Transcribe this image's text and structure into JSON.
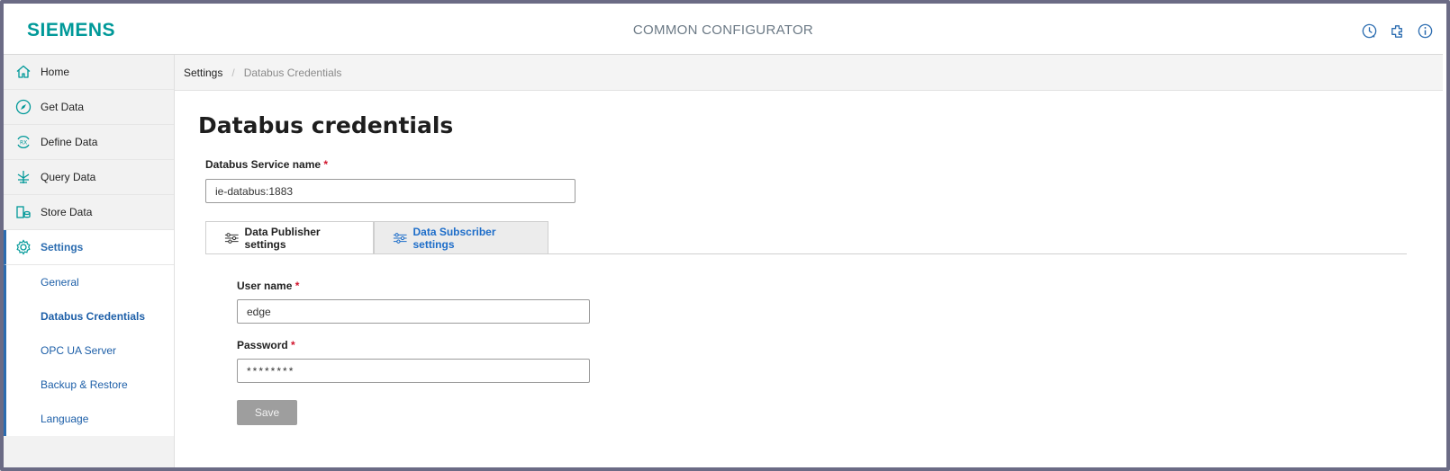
{
  "header": {
    "logo": "SIEMENS",
    "app_title": "COMMON CONFIGURATOR",
    "icons": [
      "history-icon",
      "plugin-icon",
      "info-icon"
    ],
    "brand_color": "#009999"
  },
  "sidebar": {
    "items": [
      {
        "label": "Home",
        "icon": "home-icon"
      },
      {
        "label": "Get Data",
        "icon": "get-data-icon"
      },
      {
        "label": "Define Data",
        "icon": "define-data-icon"
      },
      {
        "label": "Query Data",
        "icon": "query-data-icon"
      },
      {
        "label": "Store Data",
        "icon": "store-data-icon"
      },
      {
        "label": "Settings",
        "icon": "gear-icon"
      }
    ],
    "sub_items": [
      {
        "label": "General"
      },
      {
        "label": "Databus Credentials"
      },
      {
        "label": "OPC UA Server"
      },
      {
        "label": "Backup & Restore"
      },
      {
        "label": "Language"
      }
    ],
    "active_item": "Settings",
    "active_sub_item": "Databus Credentials"
  },
  "breadcrumb": {
    "root": "Settings",
    "separator": "/",
    "current": "Databus Credentials"
  },
  "main": {
    "title": "Databus credentials",
    "service_name": {
      "label": "Databus Service name",
      "required_mark": "*",
      "value": "ie-databus:1883"
    },
    "tabs": [
      {
        "label": "Data Publisher settings",
        "icon": "sliders-icon",
        "active": true
      },
      {
        "label": "Data Subscriber settings",
        "icon": "sliders-icon",
        "active": false
      }
    ],
    "username": {
      "label": "User name",
      "required_mark": "*",
      "value": "edge"
    },
    "password": {
      "label": "Password",
      "required_mark": "*",
      "value": "********"
    },
    "save_label": "Save"
  },
  "colors": {
    "accent": "#2b6cb0",
    "link": "#1d5fa8",
    "required": "#d1142c",
    "disabled_button": "#9e9e9e"
  }
}
